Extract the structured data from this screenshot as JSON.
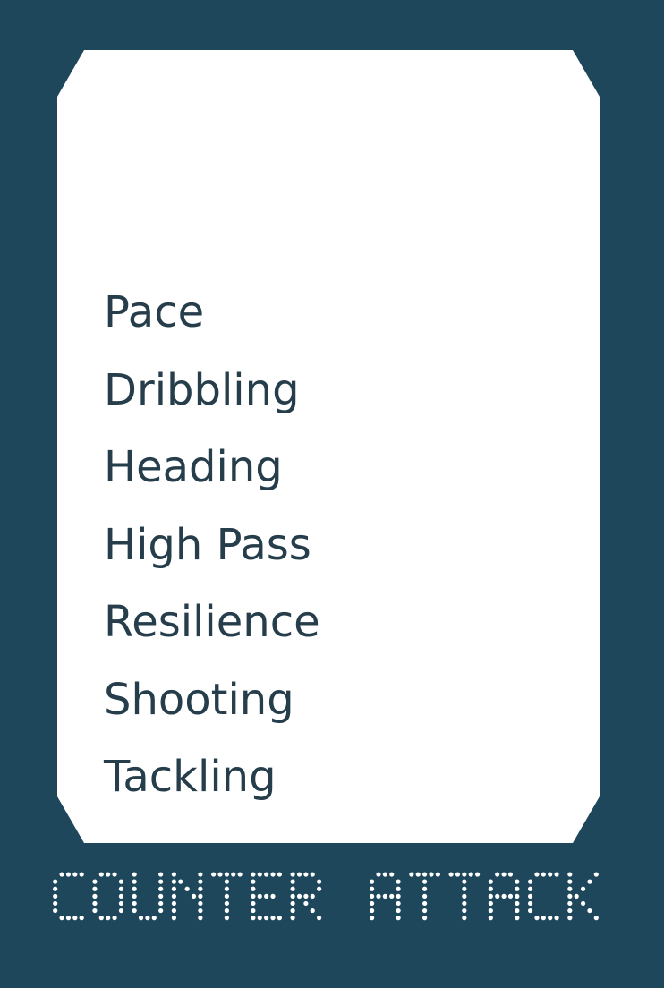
{
  "card": {
    "stats": [
      {
        "label": "Pace"
      },
      {
        "label": "Dribbling"
      },
      {
        "label": "Heading"
      },
      {
        "label": "High Pass"
      },
      {
        "label": "Resilience"
      },
      {
        "label": "Shooting"
      },
      {
        "label": "Tackling"
      }
    ]
  },
  "brand": {
    "logo_text": "COUNTER ATTACK"
  },
  "colors": {
    "frame": "#1e475c",
    "panel": "#ffffff",
    "text": "#263d4b",
    "logo_dots": "#ffffff"
  }
}
